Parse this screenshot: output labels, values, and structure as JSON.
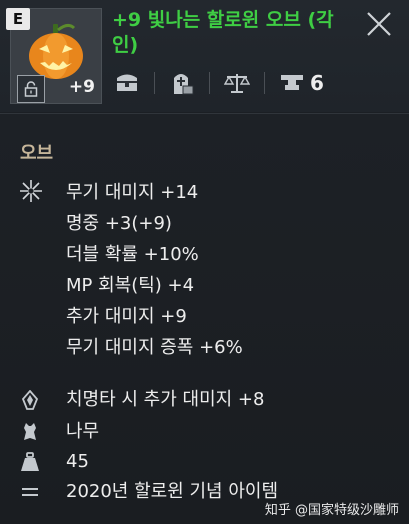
{
  "header": {
    "grade_badge": "E",
    "item_name": "+9 빛나는 할로윈 오브 (각인)",
    "enhance_level": "+9",
    "trade_count": "6"
  },
  "icons": {
    "lock": "lock-icon",
    "storage": "chest-icon",
    "tombstone": "tombstone-icon",
    "scale": "scale-icon",
    "anvil": "anvil-icon",
    "close": "close-icon",
    "sparkle": "sparkle-icon",
    "crystal": "crystal-icon",
    "hide": "leather-icon",
    "weight": "weight-icon",
    "menu": "list-icon"
  },
  "section": {
    "title": "오브"
  },
  "stats": [
    "무기 대미지 +14",
    "명중 +3(+9)",
    "더블 확률 +10%",
    "MP 회복(틱) +4",
    "추가 대미지 +9",
    "무기 대미지 증폭 +6%"
  ],
  "extras": {
    "crit": "치명타 시 추가 대미지 +8",
    "material": "나무",
    "weight": "45",
    "memo": "2020년 할로윈 기념 아이템"
  },
  "watermark": "知乎 @国家特级沙雕师",
  "colors": {
    "item_name": "#3fce44",
    "section_title": "#c6b69a",
    "background": "#1b1f24"
  }
}
